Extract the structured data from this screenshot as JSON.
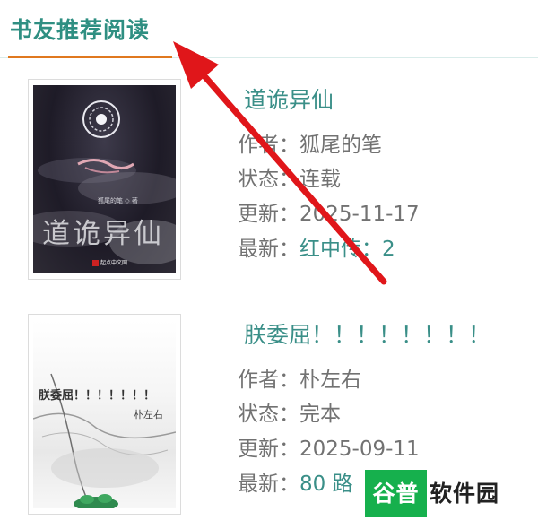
{
  "section": {
    "title": "书友推荐阅读"
  },
  "books": [
    {
      "title": "道诡异仙",
      "author_label": "作者：",
      "author": "狐尾的笔",
      "status_label": "状态：",
      "status": "连载",
      "updated_label": "更新：",
      "updated": "2025-11-17",
      "latest_label": "最新：",
      "latest": "红中传：2",
      "cover": {
        "title": "道诡异仙",
        "author_line": "狐尾的笔 ◇ 著",
        "publisher": "起点中文网"
      }
    },
    {
      "title": "朕委屈！！！！！！！！",
      "author_label": "作者：",
      "author": "朴左右",
      "status_label": "状态：",
      "status": "完本",
      "updated_label": "更新：",
      "updated": "2025-09-11",
      "latest_label": "最新：",
      "latest": "80 路",
      "cover": {
        "title": "朕委屈！！！！！！！",
        "author_line": "朴左右"
      }
    }
  ],
  "watermark": {
    "brand": "谷普",
    "text": "软件园"
  },
  "colors": {
    "accent": "#2f8f82",
    "underline": "#e0781f",
    "arrow": "#e0161a",
    "watermark_green": "#16b04d"
  }
}
